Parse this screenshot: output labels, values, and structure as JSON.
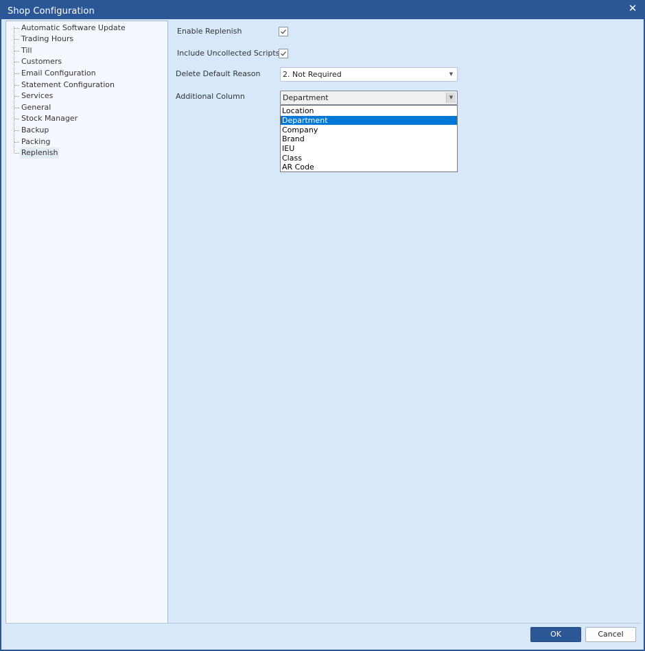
{
  "window": {
    "title": "Shop Configuration",
    "close_glyph": "✕"
  },
  "tree": {
    "items": [
      {
        "label": "Automatic Software Update"
      },
      {
        "label": "Trading Hours"
      },
      {
        "label": "Till"
      },
      {
        "label": "Customers"
      },
      {
        "label": "Email Configuration"
      },
      {
        "label": "Statement Configuration"
      },
      {
        "label": "Services"
      },
      {
        "label": "General"
      },
      {
        "label": "Stock Manager"
      },
      {
        "label": "Backup"
      },
      {
        "label": "Packing"
      },
      {
        "label": "Replenish"
      }
    ],
    "selected": "Replenish"
  },
  "form": {
    "enable_replenish": {
      "label": "Enable Replenish",
      "checked": true
    },
    "include_uncollected": {
      "label": "Include Uncollected Scripts",
      "checked": true
    },
    "delete_default_reason": {
      "label": "Delete Default Reason",
      "value": "2. Not Required"
    },
    "additional_column": {
      "label": "Additional Column",
      "value": "Department",
      "options": [
        "Location",
        "Department",
        "Company",
        "Brand",
        "IEU",
        "Class",
        "AR Code"
      ],
      "highlighted": "Department"
    }
  },
  "icons": {
    "close": "close-icon",
    "check": "checkmark-icon",
    "dropdown": "chevron-down-icon"
  },
  "colors": {
    "title_bar": "#2b5797",
    "client_bg": "#d6e8fa",
    "highlight": "#0078d7",
    "ok_button": "#2b5797"
  },
  "buttons": {
    "ok": "OK",
    "cancel": "Cancel"
  }
}
